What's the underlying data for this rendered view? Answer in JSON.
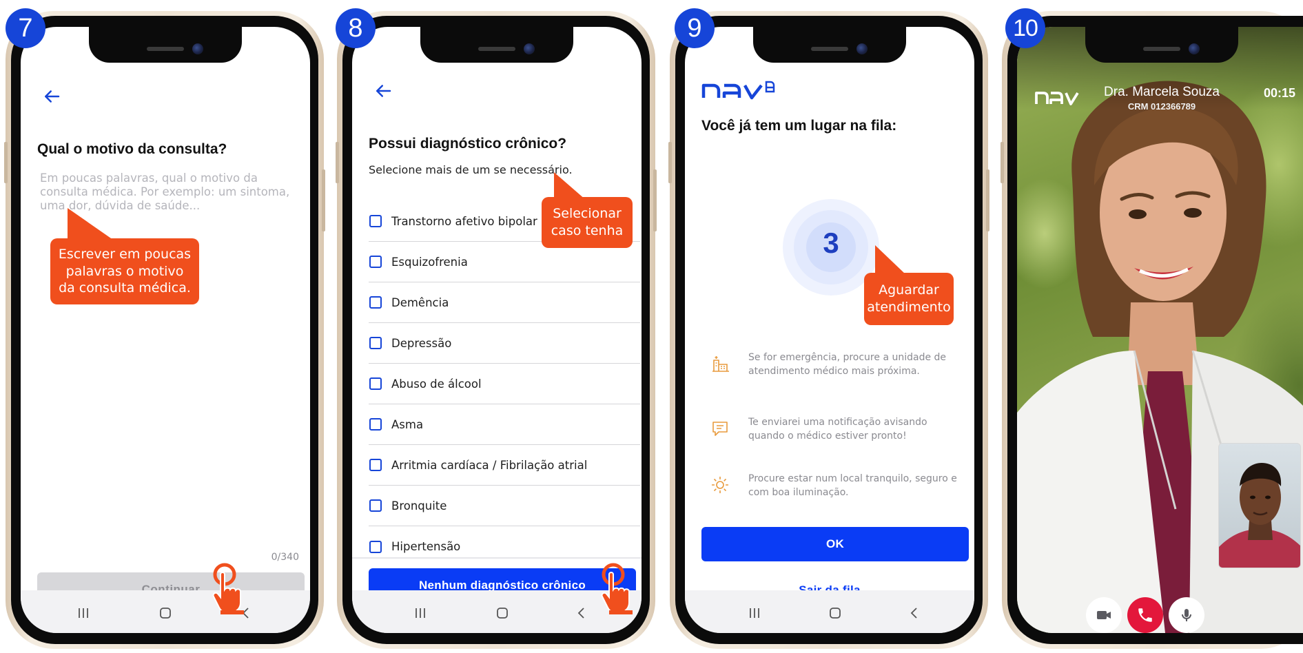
{
  "steps": [
    "7",
    "8",
    "9",
    "10"
  ],
  "screen7": {
    "title": "Qual o motivo da consulta?",
    "placeholder": "Em poucas palavras, qual o motivo da consulta médica. Por exemplo: um sintoma, uma dor, dúvida de saúde...",
    "counter": "0/340",
    "button": "Continuar",
    "callout": "Escrever em poucas palavras o motivo da consulta médica."
  },
  "screen8": {
    "title": "Possui diagnóstico crônico?",
    "subtitle": "Selecione mais de um se necessário.",
    "options": [
      "Transtorno afetivo bipolar",
      "Esquizofrenia",
      "Demência",
      "Depressão",
      "Abuso de álcool",
      "Asma",
      "Arritmia cardíaca / Fibrilação atrial",
      "Bronquite",
      "Hipertensão"
    ],
    "button": "Nenhum diagnóstico crônico",
    "callout": "Selecionar caso tenha"
  },
  "screen9": {
    "title": "Você já tem um lugar na fila:",
    "queue_position": "3",
    "info": [
      {
        "icon": "hospital-icon",
        "text": "Se for emergência, procure a unidade de atendimento médico mais próxima."
      },
      {
        "icon": "chat-icon",
        "text": "Te enviarei uma notificação avisando quando o médico estiver pronto!"
      },
      {
        "icon": "sun-icon",
        "text": "Procure estar num local tranquilo, seguro e com boa iluminação."
      }
    ],
    "ok_button": "OK",
    "leave_link": "Sair da fila",
    "callout": "Aguardar atendimento"
  },
  "screen10": {
    "doctor_name": "Dra. Marcela Souza",
    "crm": "CRM 012366789",
    "timer": "00:15"
  },
  "colors": {
    "brand_blue": "#0a3cf5",
    "badge_blue": "#1645d8",
    "callout_orange": "#f04f1d",
    "end_call_red": "#e3173b"
  }
}
